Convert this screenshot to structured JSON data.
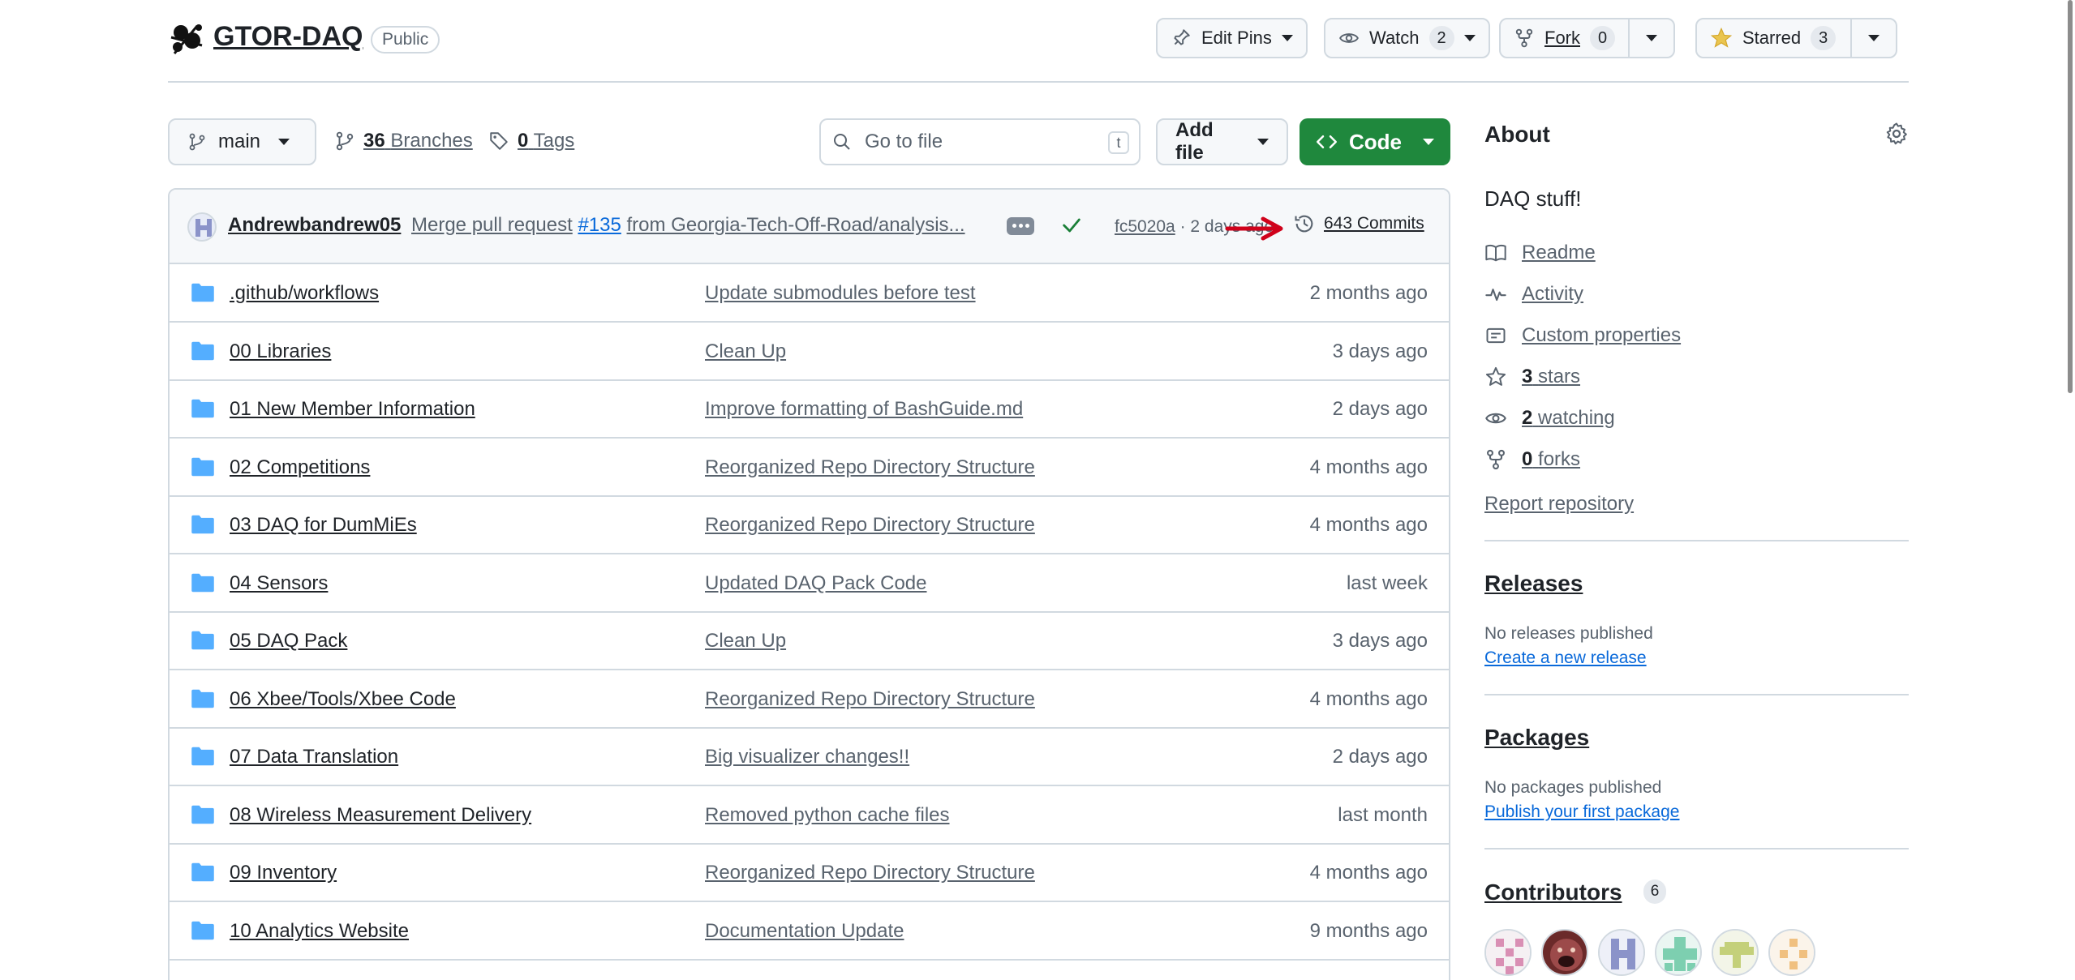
{
  "repo": {
    "name": "GTOR-DAQ",
    "visibility": "Public"
  },
  "header_actions": {
    "edit_pins": "Edit Pins",
    "watch": "Watch",
    "watch_count": "2",
    "fork": "Fork",
    "fork_count": "0",
    "starred": "Starred",
    "star_count": "3"
  },
  "file_nav": {
    "branch": "main",
    "branches_count": "36",
    "branches_label": "Branches",
    "tags_count": "0",
    "tags_label": "Tags",
    "search_placeholder": "Go to file",
    "search_shortcut": "t",
    "add_file": "Add file",
    "code": "Code"
  },
  "latest_commit": {
    "author": "Andrewbandrew05",
    "message_prefix": "Merge pull request",
    "pr_number": "#135",
    "message_suffix": "from Georgia-Tech-Off-Road/analysis...",
    "sha": "fc5020a",
    "time": "· 2 days ago",
    "commits": "643 Commits"
  },
  "files": [
    {
      "name": ".github/workflows",
      "message": "Update submodules before test",
      "date": "2 months ago"
    },
    {
      "name": "00 Libraries",
      "message": "Clean Up",
      "date": "3 days ago"
    },
    {
      "name": "01 New Member Information",
      "message": "Improve formatting of BashGuide.md",
      "date": "2 days ago"
    },
    {
      "name": "02 Competitions",
      "message": "Reorganized Repo Directory Structure",
      "date": "4 months ago"
    },
    {
      "name": "03 DAQ for DumMiEs",
      "message": "Reorganized Repo Directory Structure",
      "date": "4 months ago"
    },
    {
      "name": "04 Sensors",
      "message": "Updated DAQ Pack Code",
      "date": "last week"
    },
    {
      "name": "05 DAQ Pack",
      "message": "Clean Up",
      "date": "3 days ago"
    },
    {
      "name": "06 Xbee/Tools/Xbee Code",
      "message": "Reorganized Repo Directory Structure",
      "date": "4 months ago"
    },
    {
      "name": "07 Data Translation",
      "message": "Big visualizer changes!!",
      "date": "2 days ago"
    },
    {
      "name": "08 Wireless Measurement Delivery",
      "message": "Removed python cache files",
      "date": "last month"
    },
    {
      "name": "09 Inventory",
      "message": "Reorganized Repo Directory Structure",
      "date": "4 months ago"
    },
    {
      "name": "10 Analytics Website",
      "message": "Documentation Update",
      "date": "9 months ago"
    }
  ],
  "about": {
    "title": "About",
    "description": "DAQ stuff!",
    "readme": "Readme",
    "activity": "Activity",
    "custom_properties": "Custom properties",
    "stars_count": "3",
    "stars_label": "stars",
    "watching_count": "2",
    "watching_label": "watching",
    "forks_count": "0",
    "forks_label": "forks",
    "report": "Report repository"
  },
  "releases": {
    "title": "Releases",
    "note": "No releases published",
    "link": "Create a new release"
  },
  "packages": {
    "title": "Packages",
    "note": "No packages published",
    "link": "Publish your first package"
  },
  "contributors": {
    "title": "Contributors",
    "count": "6"
  },
  "colors": {
    "accent_green": "#1f883d",
    "link_blue": "#0969da",
    "folder_blue": "#54aeff",
    "annotation_red": "#d0021b"
  }
}
